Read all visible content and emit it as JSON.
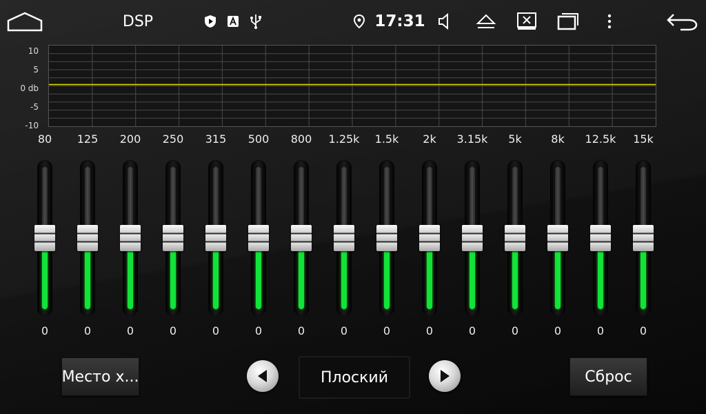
{
  "status_bar": {
    "title": "DSP",
    "time": "17:31",
    "icons": [
      "home-icon",
      "shield-icon",
      "font-a-icon",
      "usb-icon",
      "location-pin-icon",
      "volume-icon",
      "eject-icon",
      "screen-off-icon",
      "recent-apps-icon",
      "more-vert-icon",
      "back-icon"
    ]
  },
  "graph": {
    "y_labels": [
      "10",
      "5",
      "0 db",
      "-5",
      "-10"
    ],
    "ylim": [
      -10,
      10
    ],
    "curve_color": "#e8e000",
    "grid_color": "#4a4a4a"
  },
  "equalizer": {
    "bands": [
      {
        "freq": "80",
        "value": 0
      },
      {
        "freq": "125",
        "value": 0
      },
      {
        "freq": "200",
        "value": 0
      },
      {
        "freq": "250",
        "value": 0
      },
      {
        "freq": "315",
        "value": 0
      },
      {
        "freq": "500",
        "value": 0
      },
      {
        "freq": "800",
        "value": 0
      },
      {
        "freq": "1.25k",
        "value": 0
      },
      {
        "freq": "1.5k",
        "value": 0
      },
      {
        "freq": "2k",
        "value": 0
      },
      {
        "freq": "3.15k",
        "value": 0
      },
      {
        "freq": "5k",
        "value": 0
      },
      {
        "freq": "8k",
        "value": 0
      },
      {
        "freq": "12.5k",
        "value": 0
      },
      {
        "freq": "15k",
        "value": 0
      }
    ],
    "range": [
      -10,
      10
    ],
    "fill_color": "#12e23a"
  },
  "controls": {
    "location_label": "Место х...",
    "preset_label": "Плоский",
    "reset_label": "Сброс",
    "prev_icon": "triangle-left-icon",
    "next_icon": "triangle-right-icon"
  }
}
